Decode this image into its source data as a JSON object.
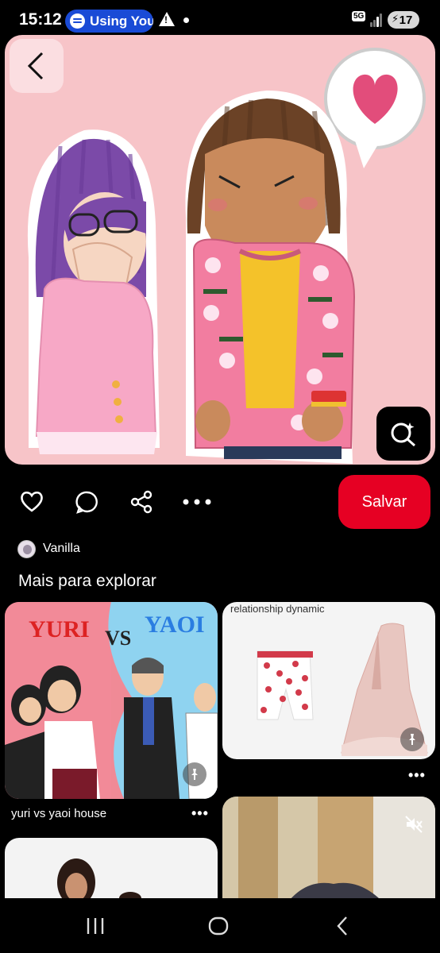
{
  "status_bar": {
    "time": "15:12",
    "media_pill": "Using You",
    "network": "5G",
    "battery": "17"
  },
  "pin": {
    "image_description_icon": "illustration-image",
    "back_icon": "chevron-left-icon",
    "visual_search_icon": "lens-search-icon"
  },
  "actions": {
    "like_icon": "heart-icon",
    "comment_icon": "comment-icon",
    "share_icon": "share-icon",
    "more_icon": "more-icon",
    "save_label": "Salvar"
  },
  "author": {
    "name": "Vanilla"
  },
  "explore": {
    "title": "Mais para explorar",
    "cards": [
      {
        "art_text_1": "YURI",
        "art_text_2": "VS",
        "art_text_3": "YAOI",
        "caption": "yuri vs yaoi house",
        "more": "•••"
      },
      {
        "title": "relationship dynamic",
        "more": "•••"
      },
      {
        "caption": ""
      },
      {
        "caption": ""
      }
    ]
  },
  "nav": {
    "recents_icon": "recents-icon",
    "home_icon": "home-icon",
    "back_icon": "back-icon"
  },
  "colors": {
    "accent": "#e60023",
    "spotify_pill": "#1a4bd6",
    "pin_background": "#f7c4c8"
  }
}
